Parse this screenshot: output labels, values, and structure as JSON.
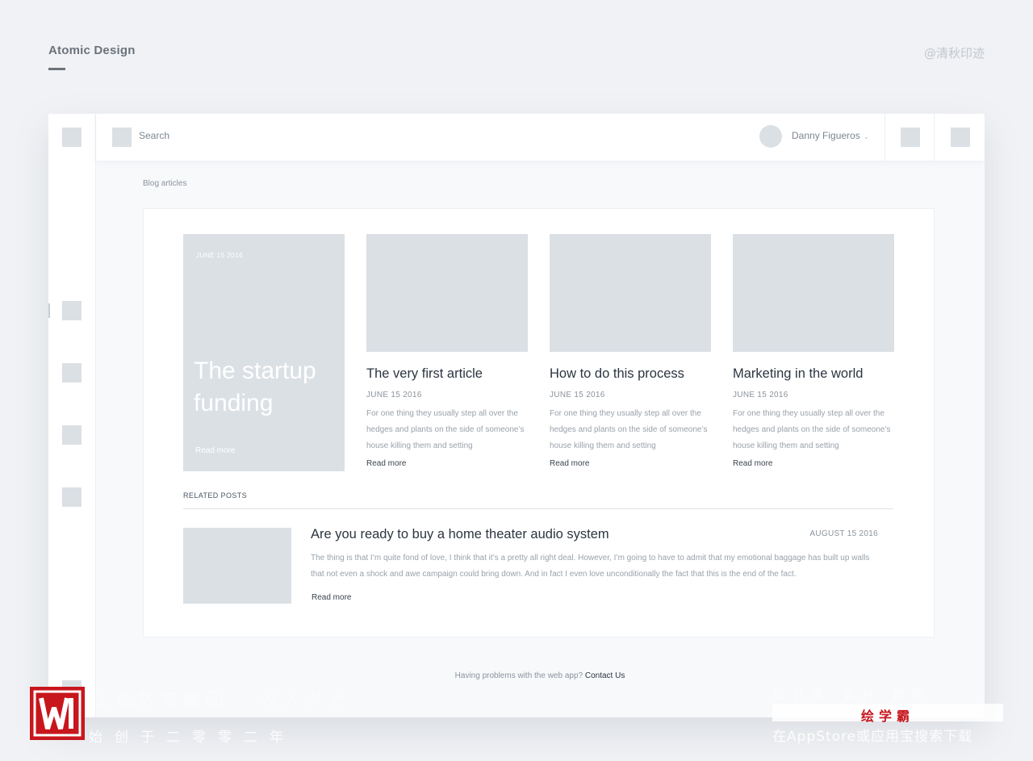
{
  "header": {
    "title": "Atomic Design",
    "credit": "@清秋印迹"
  },
  "topbar": {
    "search_label": "Search",
    "user_name": "Danny Figueros",
    "chevron": "⌄"
  },
  "breadcrumb": "Blog articles",
  "featured": {
    "date": "JUNE 15 2016",
    "title": "The startup funding",
    "read_more": "Read more"
  },
  "articles": [
    {
      "title": "The very first article",
      "date": "JUNE 15 2016",
      "excerpt": "For one thing they usually step all over the hedges and plants on the side of someone’s house killing them and setting",
      "read_more": "Read more"
    },
    {
      "title": "How to do this process",
      "date": "JUNE 15 2016",
      "excerpt": "For one thing they usually step all over the hedges and plants on the side of someone’s house killing them and setting",
      "read_more": "Read more"
    },
    {
      "title": "Marketing in the world",
      "date": "JUNE 15 2016",
      "excerpt": "For one thing they usually step all over the hedges and plants on the side of someone’s house killing them and setting",
      "read_more": "Read more"
    }
  ],
  "related": {
    "heading": "RELATED POSTS",
    "title": "Are you ready to buy a home theater audio system",
    "date": "AUGUST 15 2016",
    "text": "The thing is that I’m quite fond of love, I think that it’s a pretty all right deal. However, I’m going to have to admit that my emotional baggage has built up walls that not even a shock and awe campaign could bring down. And in fact I even love unconditionally the fact that this is the end of the fact.",
    "read_more": "Read more"
  },
  "footer": {
    "text": "Having problems with the web app?",
    "link": "Contact Us"
  },
  "watermark": {
    "left_top": "王氏教育集团 · 汉人兴大",
    "left_bottom": "始创于二零零二年",
    "right_top": "设计课·素材·教程",
    "brand": "绘学霸",
    "right_bottom": "在AppStore或应用宝搜索下载"
  },
  "colors": {
    "placeholder": "#dbe0e5",
    "background": "#f0f2f5",
    "watermark_red": "#c8161d"
  }
}
